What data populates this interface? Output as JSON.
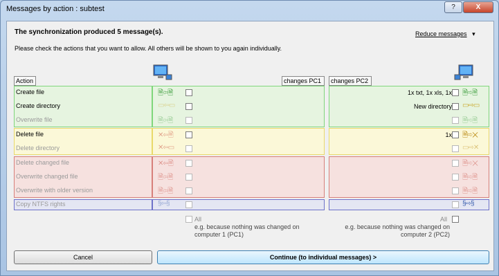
{
  "window": {
    "title": "Messages by action : subtest",
    "help_label": "?",
    "close_label": "X"
  },
  "header": {
    "heading": "The synchronization produced 5 message(s).",
    "subtext": "Please check the actions that you want to allow. All others will be shown to you again individually.",
    "reduce_label": "Reduce messages"
  },
  "columns": {
    "action": "Action",
    "pc1": "changes PC1",
    "pc2": "changes PC2"
  },
  "rows": [
    {
      "label": "Create file",
      "right_text": "1x txt, 1x xls, 1x",
      "icons_left": "🗎⇦🗎",
      "icons_right": "🗎⇨🗎"
    },
    {
      "label": "Create directory",
      "right_text": "New directory",
      "icons_left": "▭⇦▭",
      "icons_right": "▭⇨▭"
    },
    {
      "label": "Overwrite file",
      "right_text": "",
      "icons_left": "🗎⇦🗎",
      "icons_right": "🗎⇨🗎"
    },
    {
      "label": "Delete file",
      "right_text": "1x",
      "icons_left": "✕⇦🗎",
      "icons_right": "🗎⇨✕"
    },
    {
      "label": "Delete directory",
      "right_text": "",
      "icons_left": "✕⇦▭",
      "icons_right": "▭⇨✕"
    },
    {
      "label": "Delete changed file",
      "right_text": "",
      "icons_left": "✕⇦🗎",
      "icons_right": "🗎⇨✕"
    },
    {
      "label": "Overwrite changed file",
      "right_text": "",
      "icons_left": "🗎⇦🗎",
      "icons_right": "🗎⇨🗎"
    },
    {
      "label": "Overwrite with older version",
      "right_text": "",
      "icons_left": "🗎⇦🗎",
      "icons_right": "🗎⇨🗎"
    },
    {
      "label": "Copy NTFS rights",
      "right_text": "",
      "icons_left": "§⇦§",
      "icons_right": "§⇨§"
    }
  ],
  "footer": {
    "all_label": "All",
    "pc1_note": "e.g. because nothing was changed on computer 1 (PC1)",
    "pc2_note": "e.g. because nothing was changed on computer 2 (PC2)",
    "cancel_label": "Cancel",
    "continue_label": "Continue (to individual messages)  >"
  },
  "colors": {
    "green": "#7fd67b",
    "yellow": "#e9d96a",
    "red": "#d77f7a",
    "blue": "#6d71c9"
  }
}
